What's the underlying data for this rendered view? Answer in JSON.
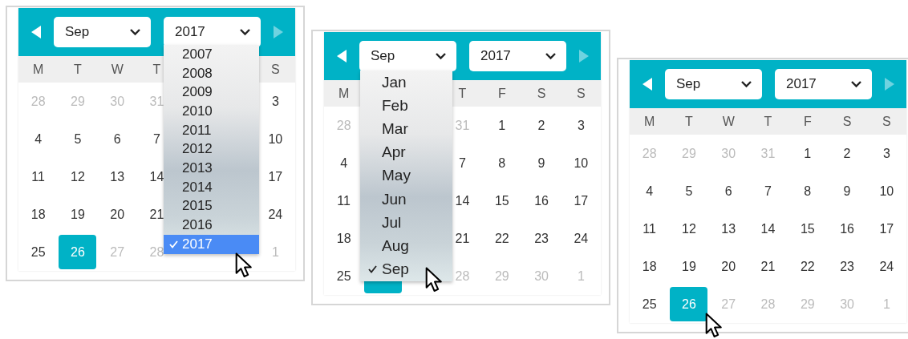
{
  "calendars": [
    {
      "prev_button": {
        "disabled": false
      },
      "next_button": {
        "disabled": true
      },
      "month_select": {
        "value": "Sep"
      },
      "year_select": {
        "value": "2017"
      },
      "weekdays": {
        "mon": "M",
        "tue": "T",
        "wed": "W",
        "thu": "T",
        "sun": "S"
      },
      "weeks": [
        {
          "mon": {
            "day": "28",
            "outside": true,
            "selected": false
          },
          "tue": {
            "day": "29",
            "outside": true,
            "selected": false
          },
          "wed": {
            "day": "30",
            "outside": true,
            "selected": false
          },
          "thu": {
            "day": "31",
            "outside": true,
            "selected": false
          },
          "sun": {
            "day": "3",
            "outside": false,
            "selected": false
          }
        },
        {
          "mon": {
            "day": "4",
            "outside": false,
            "selected": false
          },
          "tue": {
            "day": "5",
            "outside": false,
            "selected": false
          },
          "wed": {
            "day": "6",
            "outside": false,
            "selected": false
          },
          "thu": {
            "day": "7",
            "outside": false,
            "selected": false
          },
          "sun": {
            "day": "10",
            "outside": false,
            "selected": false
          }
        },
        {
          "mon": {
            "day": "11",
            "outside": false,
            "selected": false
          },
          "tue": {
            "day": "12",
            "outside": false,
            "selected": false
          },
          "wed": {
            "day": "13",
            "outside": false,
            "selected": false
          },
          "thu": {
            "day": "14",
            "outside": false,
            "selected": false
          },
          "sun": {
            "day": "17",
            "outside": false,
            "selected": false
          }
        },
        {
          "mon": {
            "day": "18",
            "outside": false,
            "selected": false
          },
          "tue": {
            "day": "19",
            "outside": false,
            "selected": false
          },
          "wed": {
            "day": "20",
            "outside": false,
            "selected": false
          },
          "thu": {
            "day": "21",
            "outside": false,
            "selected": false
          },
          "sun": {
            "day": "24",
            "outside": false,
            "selected": false
          }
        },
        {
          "mon": {
            "day": "25",
            "outside": false,
            "selected": false
          },
          "tue": {
            "day": "26",
            "outside": false,
            "selected": true
          },
          "wed": {
            "day": "27",
            "outside": true,
            "selected": false
          },
          "thu": {
            "day": "28",
            "outside": true,
            "selected": false
          },
          "sun": {
            "day": "1",
            "outside": true,
            "selected": false
          }
        }
      ],
      "dropdown": {
        "kind": "year_list",
        "highlight_selected": true,
        "options": [
          {
            "label": "2007",
            "selected": false
          },
          {
            "label": "2008",
            "selected": false
          },
          {
            "label": "2009",
            "selected": false
          },
          {
            "label": "2010",
            "selected": false
          },
          {
            "label": "2011",
            "selected": false
          },
          {
            "label": "2012",
            "selected": false
          },
          {
            "label": "2013",
            "selected": false
          },
          {
            "label": "2014",
            "selected": false
          },
          {
            "label": "2015",
            "selected": false
          },
          {
            "label": "2016",
            "selected": false
          },
          {
            "label": "2017",
            "selected": true
          }
        ]
      }
    },
    {
      "prev_button": {
        "disabled": false
      },
      "next_button": {
        "disabled": true
      },
      "month_select": {
        "value": "Sep"
      },
      "year_select": {
        "value": "2017"
      },
      "weekdays": {
        "mon": "M",
        "thu": "T",
        "fri": "F",
        "sat": "S",
        "sun": "S"
      },
      "weeks": [
        {
          "mon": {
            "day": "28",
            "outside": true,
            "selected": false
          },
          "thu": {
            "day": "31",
            "outside": true,
            "selected": false
          },
          "fri": {
            "day": "1",
            "outside": false,
            "selected": false
          },
          "sat": {
            "day": "2",
            "outside": false,
            "selected": false
          },
          "sun": {
            "day": "3",
            "outside": false,
            "selected": false
          }
        },
        {
          "mon": {
            "day": "4",
            "outside": false,
            "selected": false
          },
          "thu": {
            "day": "7",
            "outside": false,
            "selected": false
          },
          "fri": {
            "day": "8",
            "outside": false,
            "selected": false
          },
          "sat": {
            "day": "9",
            "outside": false,
            "selected": false
          },
          "sun": {
            "day": "10",
            "outside": false,
            "selected": false
          }
        },
        {
          "mon": {
            "day": "11",
            "outside": false,
            "selected": false
          },
          "thu": {
            "day": "14",
            "outside": false,
            "selected": false
          },
          "fri": {
            "day": "15",
            "outside": false,
            "selected": false
          },
          "sat": {
            "day": "16",
            "outside": false,
            "selected": false
          },
          "sun": {
            "day": "17",
            "outside": false,
            "selected": false
          }
        },
        {
          "mon": {
            "day": "18",
            "outside": false,
            "selected": false
          },
          "thu": {
            "day": "21",
            "outside": false,
            "selected": false
          },
          "fri": {
            "day": "22",
            "outside": false,
            "selected": false
          },
          "sat": {
            "day": "23",
            "outside": false,
            "selected": false
          },
          "sun": {
            "day": "24",
            "outside": false,
            "selected": false
          }
        },
        {
          "mon": {
            "day": "25",
            "outside": false,
            "selected": false
          },
          "tue": {
            "selected": true
          },
          "thu": {
            "day": "28",
            "outside": true,
            "selected": false
          },
          "fri": {
            "day": "29",
            "outside": true,
            "selected": false
          },
          "sat": {
            "day": "30",
            "outside": true,
            "selected": false
          },
          "sun": {
            "day": "1",
            "outside": true,
            "selected": false
          }
        }
      ],
      "dropdown": {
        "kind": "month_list",
        "highlight_selected": false,
        "options": [
          {
            "label": "Jan",
            "selected": false
          },
          {
            "label": "Feb",
            "selected": false
          },
          {
            "label": "Mar",
            "selected": false
          },
          {
            "label": "Apr",
            "selected": false
          },
          {
            "label": "May",
            "selected": false
          },
          {
            "label": "Jun",
            "selected": false
          },
          {
            "label": "Jul",
            "selected": false
          },
          {
            "label": "Aug",
            "selected": false
          },
          {
            "label": "Sep",
            "selected": true
          }
        ]
      }
    },
    {
      "prev_button": {
        "disabled": false
      },
      "next_button": {
        "disabled": true
      },
      "month_select": {
        "value": "Sep"
      },
      "year_select": {
        "value": "2017"
      },
      "weekdays": {
        "mon": "M",
        "tue": "T",
        "wed": "W",
        "thu": "T",
        "fri": "F",
        "sat": "S",
        "sun": "S"
      },
      "weeks": [
        {
          "mon": {
            "day": "28",
            "outside": true,
            "selected": false
          },
          "tue": {
            "day": "29",
            "outside": true,
            "selected": false
          },
          "wed": {
            "day": "30",
            "outside": true,
            "selected": false
          },
          "thu": {
            "day": "31",
            "outside": true,
            "selected": false
          },
          "fri": {
            "day": "1",
            "outside": false,
            "selected": false
          },
          "sat": {
            "day": "2",
            "outside": false,
            "selected": false
          },
          "sun": {
            "day": "3",
            "outside": false,
            "selected": false
          }
        },
        {
          "mon": {
            "day": "4",
            "outside": false,
            "selected": false
          },
          "tue": {
            "day": "5",
            "outside": false,
            "selected": false
          },
          "wed": {
            "day": "6",
            "outside": false,
            "selected": false
          },
          "thu": {
            "day": "7",
            "outside": false,
            "selected": false
          },
          "fri": {
            "day": "8",
            "outside": false,
            "selected": false
          },
          "sat": {
            "day": "9",
            "outside": false,
            "selected": false
          },
          "sun": {
            "day": "10",
            "outside": false,
            "selected": false
          }
        },
        {
          "mon": {
            "day": "11",
            "outside": false,
            "selected": false
          },
          "tue": {
            "day": "12",
            "outside": false,
            "selected": false
          },
          "wed": {
            "day": "13",
            "outside": false,
            "selected": false
          },
          "thu": {
            "day": "14",
            "outside": false,
            "selected": false
          },
          "fri": {
            "day": "15",
            "outside": false,
            "selected": false
          },
          "sat": {
            "day": "16",
            "outside": false,
            "selected": false
          },
          "sun": {
            "day": "17",
            "outside": false,
            "selected": false
          }
        },
        {
          "mon": {
            "day": "18",
            "outside": false,
            "selected": false
          },
          "tue": {
            "day": "19",
            "outside": false,
            "selected": false
          },
          "wed": {
            "day": "20",
            "outside": false,
            "selected": false
          },
          "thu": {
            "day": "21",
            "outside": false,
            "selected": false
          },
          "fri": {
            "day": "22",
            "outside": false,
            "selected": false
          },
          "sat": {
            "day": "23",
            "outside": false,
            "selected": false
          },
          "sun": {
            "day": "24",
            "outside": false,
            "selected": false
          }
        },
        {
          "mon": {
            "day": "25",
            "outside": false,
            "selected": false
          },
          "tue": {
            "day": "26",
            "outside": false,
            "selected": true
          },
          "wed": {
            "day": "27",
            "outside": true,
            "selected": false
          },
          "thu": {
            "day": "28",
            "outside": true,
            "selected": false
          },
          "fri": {
            "day": "29",
            "outside": true,
            "selected": false
          },
          "sat": {
            "day": "30",
            "outside": true,
            "selected": false
          },
          "sun": {
            "day": "1",
            "outside": true,
            "selected": false
          }
        }
      ]
    }
  ]
}
